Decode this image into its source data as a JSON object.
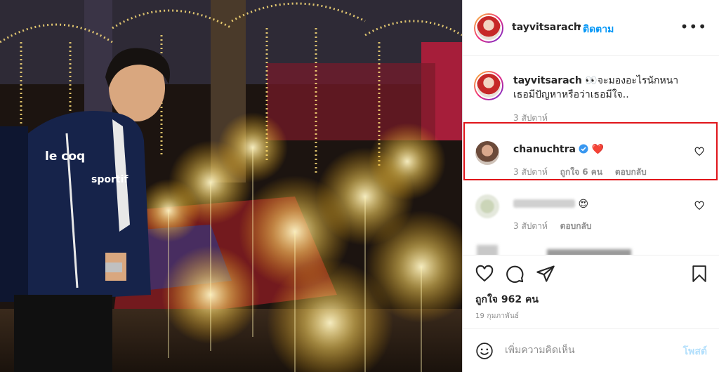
{
  "post": {
    "username": "tayvitsarach",
    "separator": "•",
    "follow_label": "ติดตาม",
    "more_icon": "more-dots-icon"
  },
  "caption": {
    "username": "tayvitsarach",
    "text_line1": "👀จะมองอะไรนักหนา",
    "text_line2": "เธอมีปัญหาหรือว่าเธอมีใจ..",
    "time": "3 สัปดาห์"
  },
  "comments": [
    {
      "username": "chanuchtra",
      "verified": true,
      "text": "❤️",
      "time": "3 สัปดาห์",
      "likes": "ถูกใจ 6 คน",
      "reply_label": "ตอบกลับ",
      "highlighted": true,
      "highlight_color": "#e0141a"
    },
    {
      "username": "",
      "text": "😍",
      "time": "3 สัปดาห์",
      "reply_label": "ตอบกลับ",
      "blurred": true
    }
  ],
  "actions": {
    "like_icon": "heart-icon",
    "comment_icon": "comment-icon",
    "share_icon": "share-icon",
    "save_icon": "bookmark-icon",
    "likes_text": "ถูกใจ 962 คน",
    "date_text": "19 กุมภาพันธ์"
  },
  "composer": {
    "emoji_icon": "smiley-icon",
    "placeholder": "เพิ่มความคิดเห็น",
    "post_label": "โพสต์"
  },
  "colors": {
    "link_blue": "#0095f6",
    "post_disabled": "#b2dffc",
    "verified_blue": "#3897f0",
    "heart_red": "#ed4956"
  }
}
